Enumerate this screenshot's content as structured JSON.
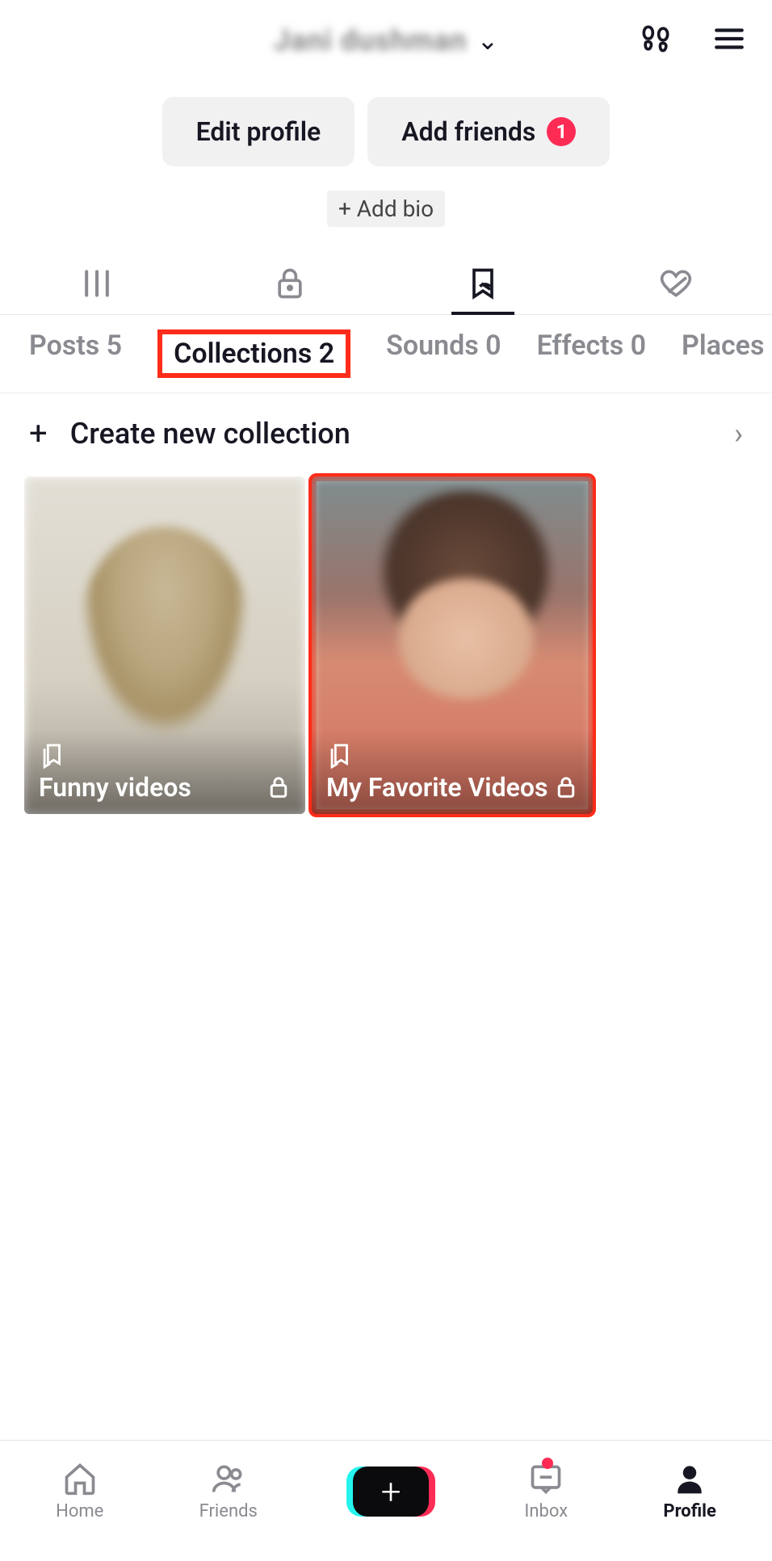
{
  "header": {
    "username": "Jani dushman",
    "footprint_icon": "footprint-icon",
    "menu_icon": "hamburger-icon"
  },
  "actions": {
    "edit_profile": "Edit profile",
    "add_friends": "Add friends",
    "add_friends_badge": "1",
    "add_bio": "+ Add bio"
  },
  "content_tabs": {
    "icons": [
      "grid-icon",
      "lock-icon",
      "bookmark-hidden-icon",
      "heart-hidden-icon"
    ],
    "active_index": 2
  },
  "sub_tabs": [
    {
      "label": "Posts 5",
      "active": false,
      "highlight": false
    },
    {
      "label": "Collections 2",
      "active": true,
      "highlight": true
    },
    {
      "label": "Sounds 0",
      "active": false,
      "highlight": false
    },
    {
      "label": "Effects 0",
      "active": false,
      "highlight": false
    },
    {
      "label": "Places",
      "active": false,
      "highlight": false
    }
  ],
  "create_row": {
    "plus": "+",
    "label": "Create new collection"
  },
  "collections": [
    {
      "name": "Funny videos",
      "private": true,
      "highlight": false
    },
    {
      "name": "My Favorite Videos",
      "private": true,
      "highlight": true
    }
  ],
  "bottom_nav": {
    "items": [
      {
        "label": "Home",
        "icon": "home-icon",
        "active": false,
        "dot": false
      },
      {
        "label": "Friends",
        "icon": "friends-icon",
        "active": false,
        "dot": false
      },
      {
        "label": "",
        "icon": "create-icon",
        "active": false,
        "dot": false
      },
      {
        "label": "Inbox",
        "icon": "inbox-icon",
        "active": false,
        "dot": true
      },
      {
        "label": "Profile",
        "icon": "profile-icon",
        "active": true,
        "dot": false
      }
    ]
  },
  "colors": {
    "accent": "#fe2c55",
    "highlight": "#fe2c1a"
  }
}
